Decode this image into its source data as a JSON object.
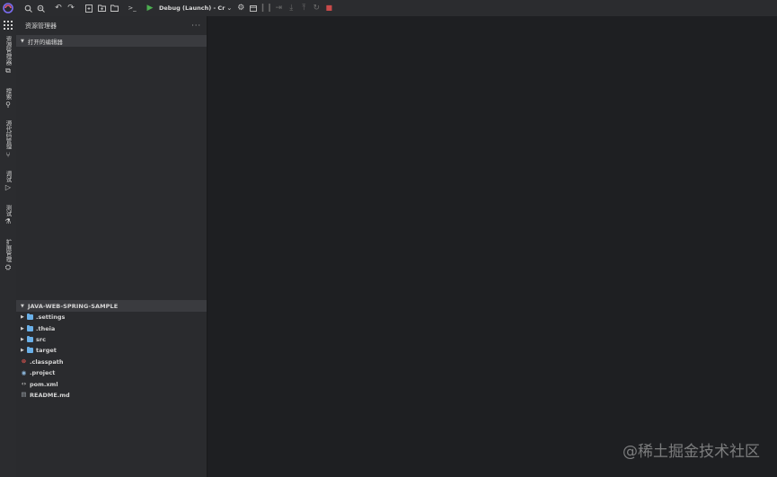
{
  "toolbar": {
    "debug_config": "Debug (Launch) - Cr",
    "icons": [
      "search-icon",
      "zoom-icon",
      "undo-icon",
      "redo-icon",
      "new-file-icon",
      "new-folder-icon",
      "open-folder-icon",
      "terminal-icon",
      "run-icon",
      "debug-settings-icon",
      "debug-console-icon",
      "pause-icon",
      "step-over-icon",
      "step-into-icon",
      "step-out-icon",
      "restart-icon",
      "stop-icon"
    ]
  },
  "activity_bar": {
    "items": [
      {
        "label": "资源管理器",
        "icon": "files-icon"
      },
      {
        "label": "搜索",
        "icon": "search-icon"
      },
      {
        "label": "源代码管理",
        "icon": "source-control-icon"
      },
      {
        "label": "调试",
        "icon": "debug-icon"
      },
      {
        "label": "测试",
        "icon": "test-icon"
      },
      {
        "label": "扩展管理",
        "icon": "extensions-icon"
      }
    ]
  },
  "sidebar": {
    "title": "资源管理器",
    "more": "···",
    "open_editors_label": "打开的编辑器",
    "project_label": "JAVA-WEB-SPRING-SAMPLE",
    "tree": [
      {
        "name": ".settings",
        "type": "folder"
      },
      {
        "name": ".theia",
        "type": "folder"
      },
      {
        "name": "src",
        "type": "folder"
      },
      {
        "name": "target",
        "type": "folder"
      },
      {
        "name": ".classpath",
        "type": "file"
      },
      {
        "name": ".project",
        "type": "file"
      },
      {
        "name": "pom.xml",
        "type": "file"
      },
      {
        "name": "README.md",
        "type": "file"
      }
    ]
  },
  "watermark": "@稀土掘金技术社区",
  "colors": {
    "toolbar_bg": "#2b2c2f",
    "sidebar_bg": "#2a2b2e",
    "editor_bg": "#1e1f22",
    "folder": "#6ab0e8",
    "run": "#4caf50",
    "stop": "#c94a4a"
  }
}
